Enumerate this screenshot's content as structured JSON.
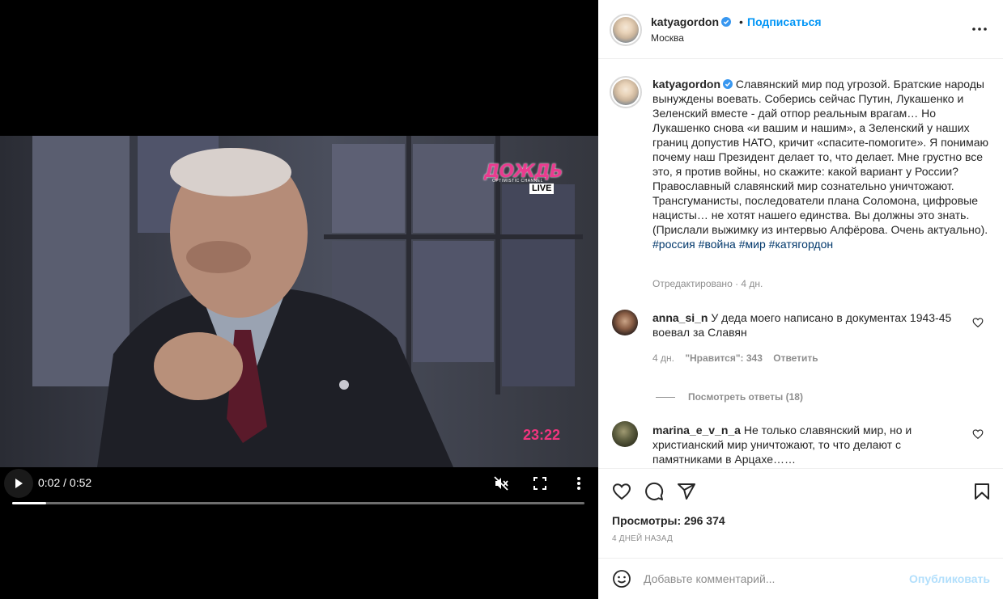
{
  "video": {
    "channel_name": "ДОЖДЬ",
    "channel_sub": "OPTIMISTIC CHANNEL",
    "live_label": "LIVE",
    "time_overlay": "23:22",
    "time_readout": "0:02 / 0:52",
    "progress_fraction": 0.06,
    "muted": true
  },
  "header": {
    "username": "katyagordon",
    "dot": "•",
    "follow_label": "Подписаться",
    "location": "Москва",
    "more_icon": "more-horizontal-icon"
  },
  "caption": {
    "username": "katyagordon",
    "text": "Славянский мир под угрозой. Братские народы вынуждены воевать. Соберись сейчас Путин, Лукашенко и Зеленский вместе - дай отпор реальным врагам… Но Лукашенко снова «и вашим и нашим», а Зеленский у наших границ допустив НАТО, кричит «спасите-помогите». Я понимаю почему наш Президент делает то, что делает. Мне грустно все это, я против войны, но скажите: какой вариант у России? Православный славянский мир сознательно уничтожают. Трансгуманисты, последователи плана Соломона, цифровые нацисты… не хотят нашего единства. Вы должны это знать. (Прислали выжимку из интервью Алфёрова. Очень актуально).",
    "hashtags": [
      "#россия",
      "#война",
      "#мир",
      "#катягордон"
    ],
    "meta": "Отредактировано · 4 дн."
  },
  "comments": [
    {
      "username": "anna_si_n",
      "text": "У деда моего написано в документах 1943-45 воевал за Славян",
      "age": "4 дн.",
      "likes": "\"Нравится\": 343",
      "reply_label": "Ответить",
      "view_replies": "Посмотреть ответы (18)"
    },
    {
      "username": "marina_e_v_n_a",
      "text": "Не только славянский мир, но и христианский мир уничтожают, то что делают с памятниками в Арцахе……"
    }
  ],
  "footer": {
    "views": "Просмотры: 296 374",
    "date": "4 ДНЕЙ НАЗАД",
    "comment_placeholder": "Добавьте комментарий...",
    "publish_label": "Опубликовать"
  },
  "colors": {
    "accent": "#0095f6",
    "hashtag": "#00376b",
    "muted_text": "#8e8e8e",
    "publish_disabled": "#b2dffc",
    "channel_pink": "#e93c8f"
  }
}
